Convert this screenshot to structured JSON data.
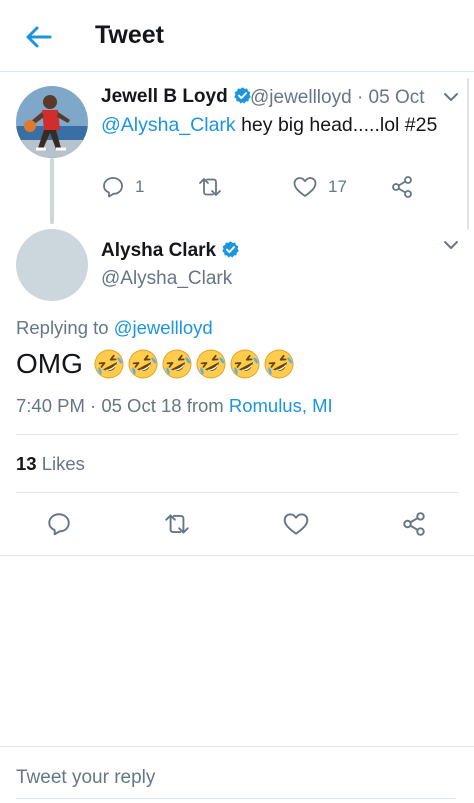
{
  "header": {
    "title": "Tweet"
  },
  "parent_tweet": {
    "name": "Jewell B Loyd",
    "handle_date": "@jewellloyd · 05 Oct",
    "mention": "@Alysha_Clark",
    "text": " hey big head.....lol #25",
    "actions": {
      "reply_count": "1",
      "retweet_count": "",
      "like_count": "17"
    }
  },
  "main_tweet": {
    "name": "Alysha Clark",
    "handle": "@Alysha_Clark",
    "replying_prefix": "Replying to ",
    "replying_to": "@jewellloyd",
    "text": "OMG",
    "emojis": [
      "rolling-on-floor-laughing",
      "rolling-on-floor-laughing",
      "rolling-on-floor-laughing",
      "rolling-on-floor-laughing",
      "rolling-on-floor-laughing",
      "rolling-on-floor-laughing"
    ],
    "timestamp": "7:40 PM · 05 Oct 18",
    "from_label": " from ",
    "location": "Romulus, MI",
    "likes_count": "13",
    "likes_label": " Likes"
  },
  "reply_box": {
    "placeholder": "Tweet your reply"
  },
  "colors": {
    "accent": "#1b95e0",
    "muted": "#657786",
    "border": "#e1e8ed"
  }
}
